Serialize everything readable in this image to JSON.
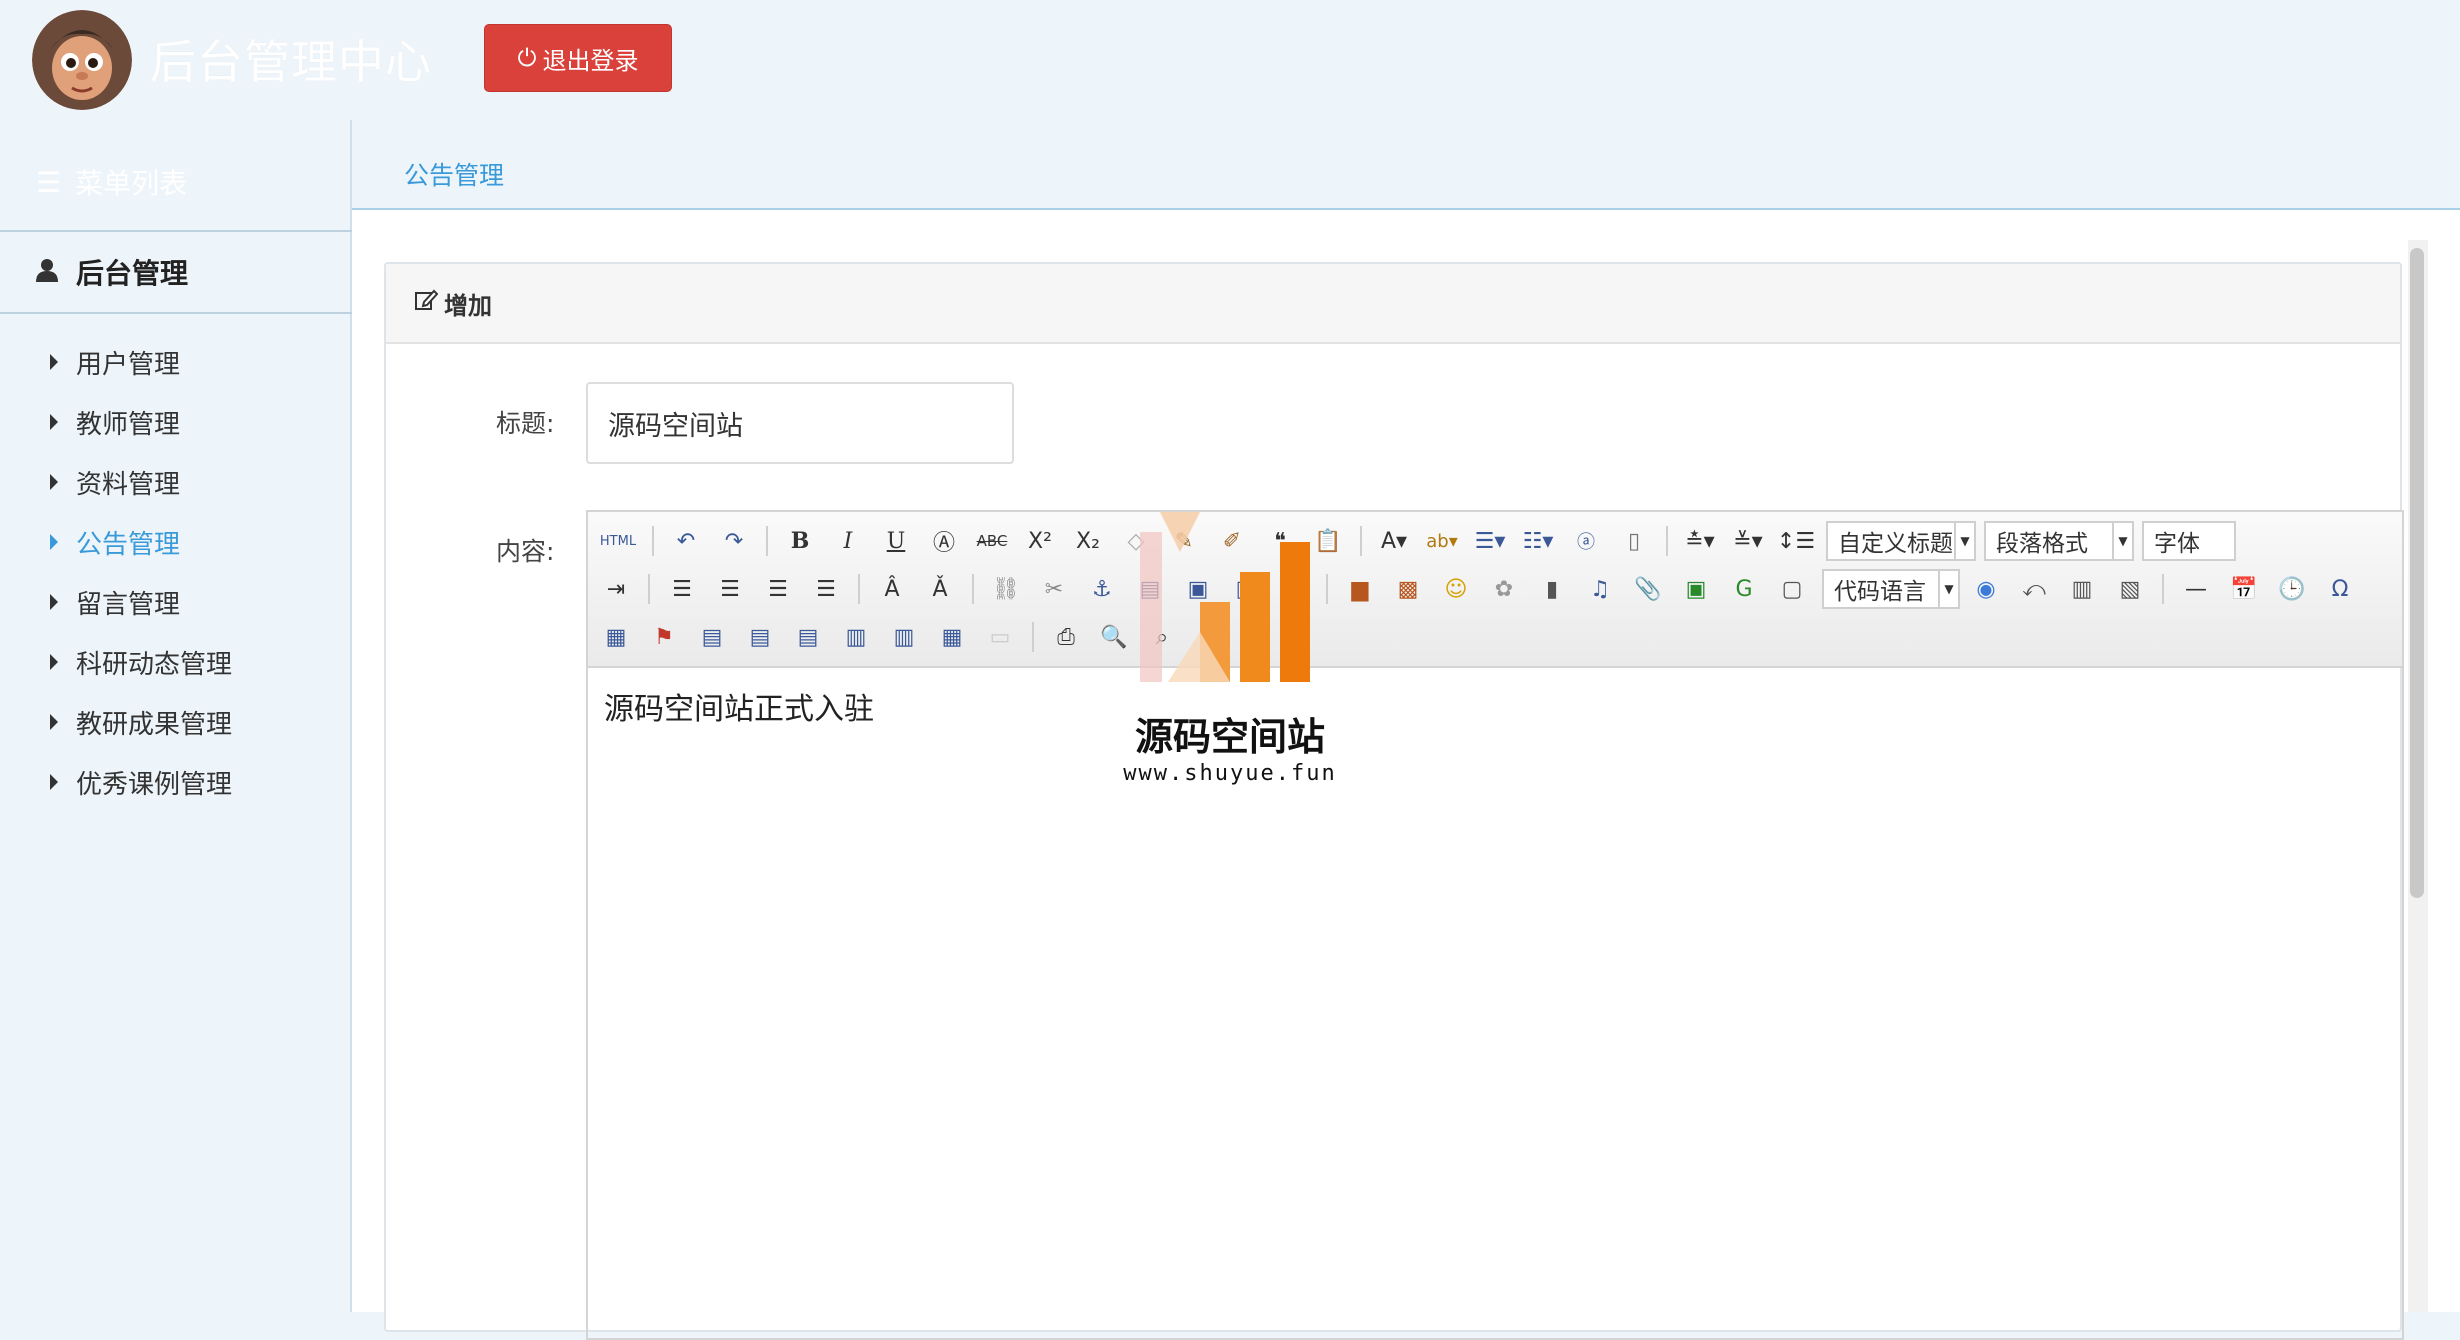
{
  "header": {
    "site_title": "后台管理中心",
    "logout_label": "退出登录"
  },
  "sidebar": {
    "menu_toggle_label": "菜单列表",
    "group_title": "后台管理",
    "items": [
      {
        "label": "用户管理",
        "active": false
      },
      {
        "label": "教师管理",
        "active": false
      },
      {
        "label": "资料管理",
        "active": false
      },
      {
        "label": "公告管理",
        "active": true
      },
      {
        "label": "留言管理",
        "active": false
      },
      {
        "label": "科研动态管理",
        "active": false
      },
      {
        "label": "教研成果管理",
        "active": false
      },
      {
        "label": "优秀课例管理",
        "active": false
      }
    ]
  },
  "breadcrumb": "公告管理",
  "panel": {
    "heading": "增加",
    "title_label": "标题:",
    "title_value": "源码空间站",
    "content_label": "内容:",
    "editor_content": "源码空间站正式入驻",
    "toolbar": {
      "html_label": "HTML",
      "select_custom_title": "自定义标题",
      "select_paragraph": "段落格式",
      "select_font": "字体",
      "select_code_lang": "代码语言"
    }
  },
  "watermark": {
    "title": "源码空间站",
    "url": "www.shuyue.fun"
  },
  "colors": {
    "accent": "#3a9ad9",
    "danger": "#d9413a",
    "background": "#eef5fa"
  }
}
